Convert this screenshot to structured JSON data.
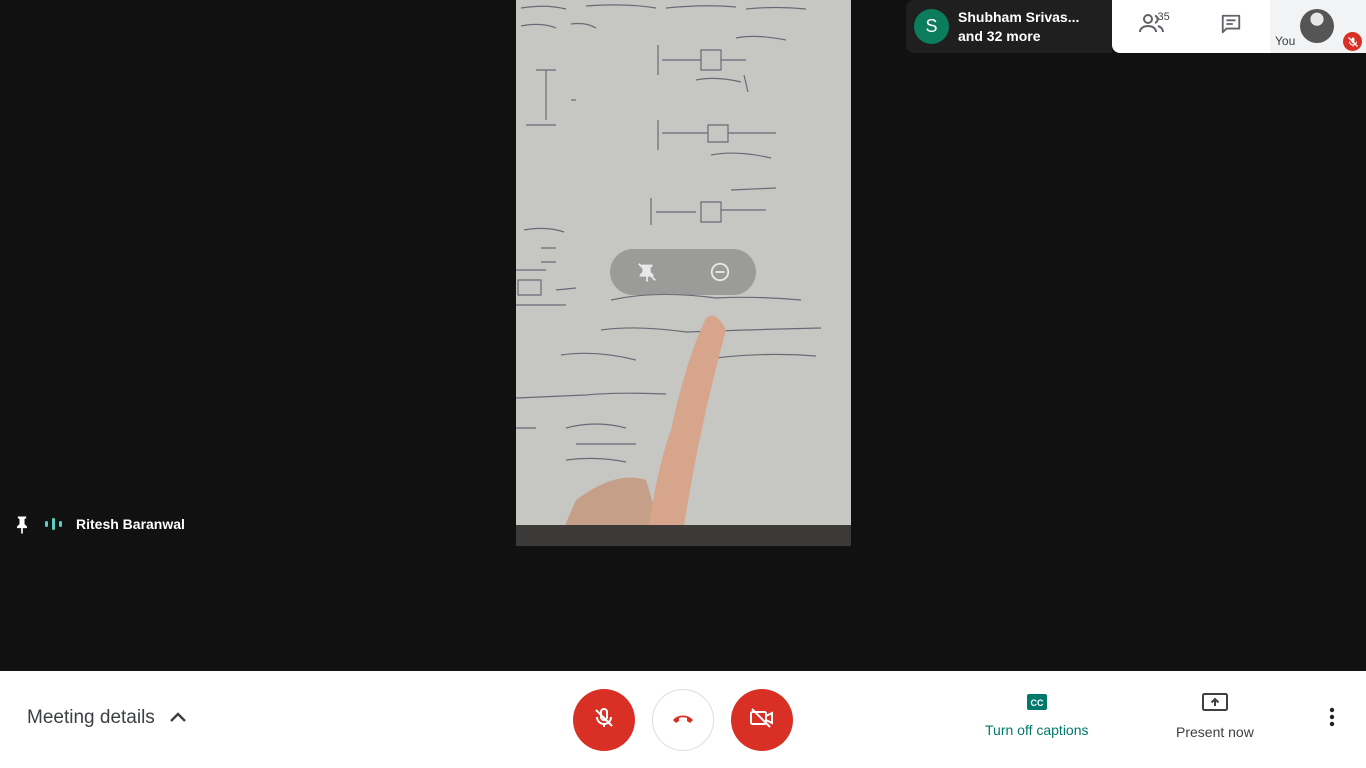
{
  "stage": {
    "speaker_name": "Ritesh Baranwal",
    "pin_icon": "pin-icon",
    "audio_icon": "audio-level-icon"
  },
  "presenting": {
    "avatar_letter": "S",
    "name": "Shubham Srivas...",
    "more_text": "and 32 more",
    "avatar_color": "#0c7d5c"
  },
  "top_panel": {
    "people_count": "35",
    "people_icon": "people-icon",
    "chat_icon": "chat-icon",
    "self_label": "You",
    "self_mute_icon": "mic-off-icon"
  },
  "toolbar": {
    "meeting_details_label": "Meeting details",
    "mic_icon": "mic-off-icon",
    "hangup_icon": "phone-hangup-icon",
    "camera_icon": "camera-off-icon",
    "captions_label": "Turn off captions",
    "captions_icon": "cc-icon",
    "present_label": "Present now",
    "present_icon": "present-screen-icon",
    "more_icon": "more-vert-icon",
    "accent_color": "#00796b",
    "danger_color": "#d93025"
  }
}
